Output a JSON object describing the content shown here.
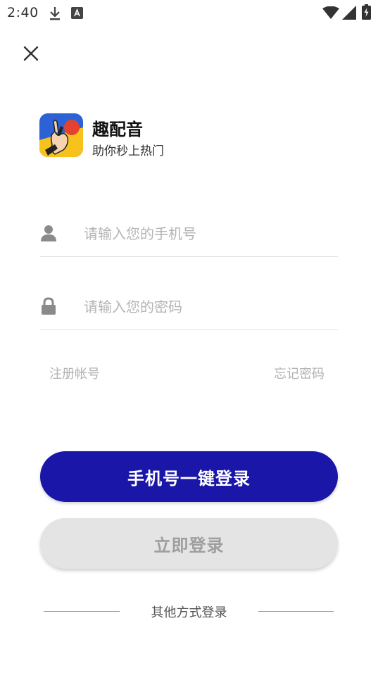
{
  "status_bar": {
    "time": "2:40",
    "icons": [
      "download-icon",
      "keyboard-a-icon",
      "wifi-icon",
      "signal-icon",
      "battery-charging-icon"
    ]
  },
  "app": {
    "name": "趣配音",
    "slogan": "助你秒上热门"
  },
  "form": {
    "phone_placeholder": "请输入您的手机号",
    "password_placeholder": "请输入您的密码",
    "phone_value": "",
    "password_value": ""
  },
  "links": {
    "register": "注册帐号",
    "forgot_password": "忘记密码"
  },
  "buttons": {
    "one_click_login": "手机号一键登录",
    "login_now": "立即登录"
  },
  "footer": {
    "other_login": "其他方式登录"
  },
  "colors": {
    "primary": "#1a16a8",
    "secondary_button": "#e4e4e4",
    "placeholder": "#b4b4b4"
  }
}
